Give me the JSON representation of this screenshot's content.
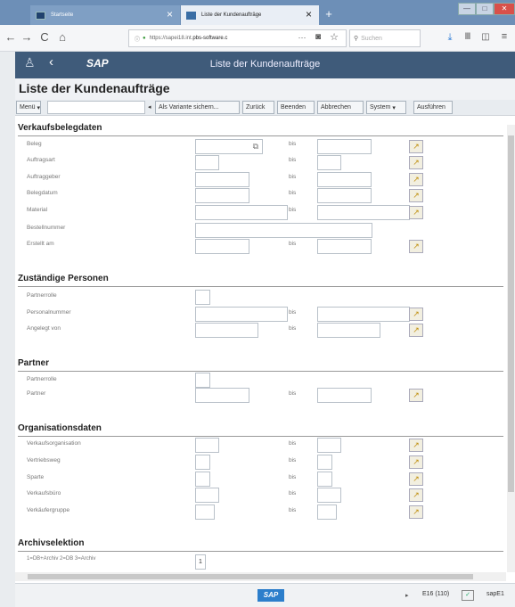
{
  "browser": {
    "tabs": [
      {
        "title": "Startseite",
        "close": "×"
      },
      {
        "title": "Liste der Kundenaufträge",
        "close": "×"
      }
    ],
    "new_tab": "+",
    "url_prefix": "https://sapei18.int.",
    "url_domain": "pbs-software.c",
    "url_more": "···",
    "search_placeholder": "Suchen",
    "window": {
      "minimize": "—",
      "maximize": "□",
      "close": "✕"
    }
  },
  "shell": {
    "title": "Liste der Kundenaufträge",
    "logo": "SAP"
  },
  "page": {
    "title": "Liste der Kundenaufträge"
  },
  "toolbar": {
    "menu": "Menü",
    "variant": "Als Variante sichern...",
    "back": "Zurück",
    "exit": "Beenden",
    "cancel": "Abbrechen",
    "system": "System",
    "execute": "Ausführen"
  },
  "bis": "bis",
  "sections": {
    "verkauf": {
      "title": "Verkaufsbelegdaten",
      "rows": [
        "Beleg",
        "Auftragsart",
        "Auftraggeber",
        "Belegdatum",
        "Material",
        "Bestellnummer",
        "Erstellt am"
      ]
    },
    "personen": {
      "title": "Zuständige Personen",
      "rows": [
        "Partnerrolle",
        "Personalnummer",
        "Angelegt von"
      ]
    },
    "partner": {
      "title": "Partner",
      "rows": [
        "Partnerrolle",
        "Partner"
      ]
    },
    "org": {
      "title": "Organisationsdaten",
      "rows": [
        "Verkaufsorganisation",
        "Vertriebsweg",
        "Sparte",
        "Verkaufsbüro",
        "Verkäufergruppe"
      ]
    },
    "archiv": {
      "title": "Archivselektion",
      "rows": [
        "1=DB+Archiv 2=DB 3=Archiv"
      ],
      "value": "1"
    }
  },
  "status": {
    "session": "E16 (110)",
    "server": "sapE1"
  },
  "colors": {
    "shell": "#3f5b7a",
    "tabbar": "#6d8fb7",
    "button_icon": "#c09010"
  }
}
